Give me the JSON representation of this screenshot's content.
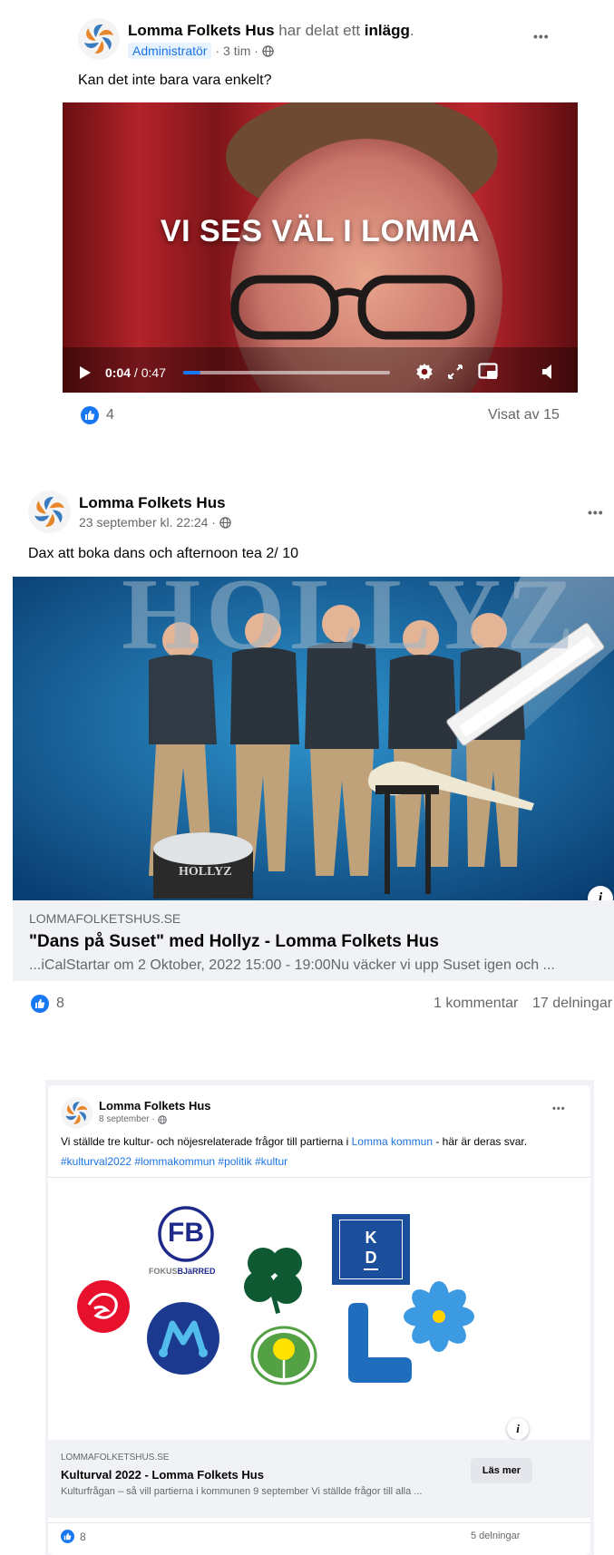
{
  "post1": {
    "author": "Lomma Folkets Hus",
    "shared_text": "har delat ett",
    "shared_object": "inlägg",
    "shared_suffix": ".",
    "badge": "Administratör",
    "time": "· 3 tim ·",
    "text": "Kan det inte bara vara enkelt?",
    "video": {
      "overlay_text": "VI SES VÄL I LOMMA",
      "current_time": "0:04",
      "duration": "/ 0:47",
      "progress": 0.085
    },
    "likes": "4",
    "views": "Visat av 15"
  },
  "post2": {
    "author": "Lomma Folkets Hus",
    "time": "23 september kl. 22:24 ·",
    "text": "Dax att boka dans och afternoon tea 2/ 10",
    "image": {
      "backdrop_text": "HOLLYZ",
      "drum_text": "HOLLYZ"
    },
    "link": {
      "domain": "LOMMAFOLKETSHUS.SE",
      "title": "\"Dans på Suset\" med Hollyz - Lomma Folkets Hus",
      "description": "...iCalStartar om 2 Oktober, 2022 15:00 - 19:00Nu väcker vi upp Suset igen och ..."
    },
    "likes": "8",
    "comments": "1 kommentar",
    "shares": "17 delningar"
  },
  "post3": {
    "author": "Lomma Folkets Hus",
    "time": "8 september ·",
    "text_before": "Vi ställde tre kultur- och nöjesrelaterade frågor till partierna i",
    "text_link": "Lomma kommun",
    "text_after": "- här är deras svar.",
    "hashtags": "#kulturval2022 #lommakommun #politik #kultur",
    "logos": {
      "fb_letters": "FB",
      "fb_caption_1": "FOKUS",
      "fb_caption_2": "BJäRRED",
      "kd_top": "K",
      "kd_bottom": "D"
    },
    "link": {
      "domain": "LOMMAFOLKETSHUS.SE",
      "title": "Kulturval 2022 - Lomma Folkets Hus",
      "description": "Kulturfrågan – så vill partierna i kommunen 9 september Vi ställde frågor till alla ...",
      "button": "Läs mer"
    },
    "likes": "8",
    "shares": "5 delningar"
  },
  "icons": {
    "more": "•••",
    "info": "i",
    "globe": "globe-icon",
    "like": "thumbs-up-icon"
  },
  "colors": {
    "brand_blue": "#1877f2",
    "link_blue": "#1b74e4",
    "video_bg": "#9b1b1e"
  }
}
